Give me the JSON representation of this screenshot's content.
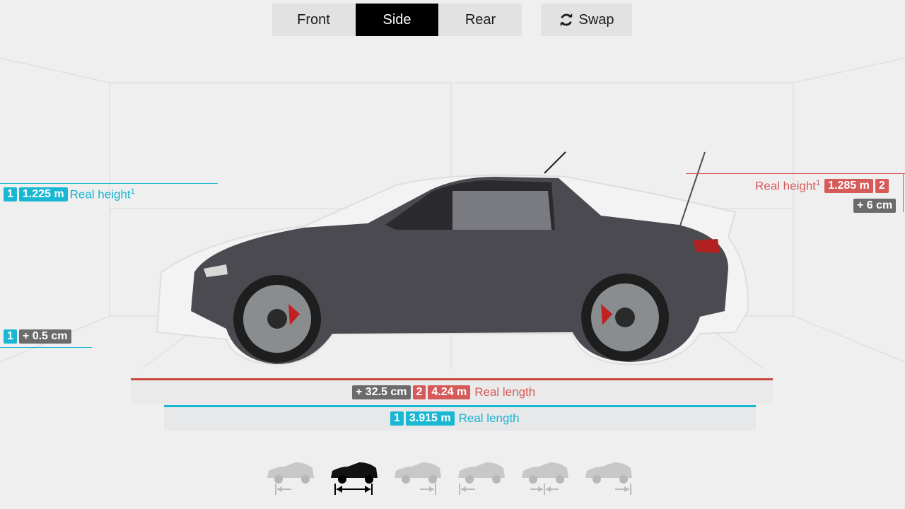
{
  "views": {
    "front": "Front",
    "side": "Side",
    "rear": "Rear",
    "active": "Side"
  },
  "swap_label": "Swap",
  "car1": {
    "badge": "1",
    "height_value": "1.225 m",
    "height_label": "Real height",
    "ground_diff": "+ 0.5 cm",
    "length_value": "3.915 m",
    "length_label": "Real length",
    "color": "#1ab7d3"
  },
  "car2": {
    "badge": "2",
    "height_value": "1.285 m",
    "height_label": "Real height",
    "height_diff": "+ 6 cm",
    "length_value": "4.24 m",
    "length_label": "Real length",
    "length_diff": "+ 32.5 cm",
    "color": "#d65a5a"
  },
  "footnote_marker": "1",
  "thumbnails": [
    {
      "name": "align-left",
      "active": false
    },
    {
      "name": "align-center-expand",
      "active": true
    },
    {
      "name": "align-right",
      "active": false
    },
    {
      "name": "align-left-2",
      "active": false
    },
    {
      "name": "align-center-contract",
      "active": false
    },
    {
      "name": "align-right-2",
      "active": false
    }
  ]
}
